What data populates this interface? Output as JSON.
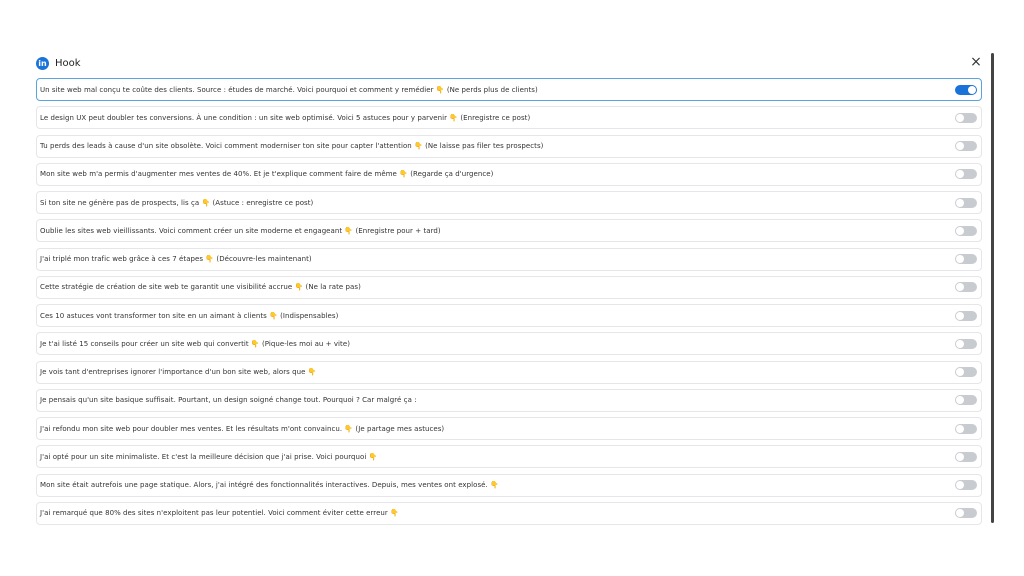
{
  "header": {
    "title": "Hook",
    "logo_text": "in",
    "close_label": "×"
  },
  "accent_color": "#1a73d9",
  "items": [
    {
      "text": "Un site web mal conçu te coûte des clients. Source : études de marché. Voici pourquoi et comment y remédier 👇 (Ne perds plus de clients)",
      "enabled": true
    },
    {
      "text": "Le design UX peut doubler tes conversions. À une condition : un site web optimisé. Voici 5 astuces pour y parvenir 👇 (Enregistre ce post)",
      "enabled": false
    },
    {
      "text": "Tu perds des leads à cause d'un site obsolète. Voici comment moderniser ton site pour capter l'attention 👇 (Ne laisse pas filer tes prospects)",
      "enabled": false
    },
    {
      "text": "Mon site web m'a permis d'augmenter mes ventes de 40%. Et je t'explique comment faire de même 👇 (Regarde ça d'urgence)",
      "enabled": false
    },
    {
      "text": "Si ton site ne génère pas de prospects, lis ça 👇 (Astuce : enregistre ce post)",
      "enabled": false
    },
    {
      "text": "Oublie les sites web vieillissants. Voici comment créer un site moderne et engageant 👇 (Enregistre pour + tard)",
      "enabled": false
    },
    {
      "text": "J'ai triplé mon trafic web grâce à ces 7 étapes 👇 (Découvre-les maintenant)",
      "enabled": false
    },
    {
      "text": "Cette stratégie de création de site web te garantit une visibilité accrue 👇 (Ne la rate pas)",
      "enabled": false
    },
    {
      "text": "Ces 10 astuces vont transformer ton site en un aimant à clients 👇 (Indispensables)",
      "enabled": false
    },
    {
      "text": "Je t'ai listé 15 conseils pour créer un site web qui convertit 👇 (Pique-les moi au + vite)",
      "enabled": false
    },
    {
      "text": "Je vois tant d'entreprises ignorer l'importance d'un bon site web, alors que 👇",
      "enabled": false
    },
    {
      "text": "Je pensais qu'un site basique suffisait. Pourtant, un design soigné change tout. Pourquoi ? Car malgré ça :",
      "enabled": false
    },
    {
      "text": "J'ai refondu mon site web pour doubler mes ventes. Et les résultats m'ont convaincu. 👇 (Je partage mes astuces)",
      "enabled": false
    },
    {
      "text": "J'ai opté pour un site minimaliste. Et c'est la meilleure décision que j'ai prise. Voici pourquoi 👇",
      "enabled": false
    },
    {
      "text": "Mon site était autrefois une page statique. Alors, j'ai intégré des fonctionnalités interactives. Depuis, mes ventes ont explosé. 👇",
      "enabled": false
    },
    {
      "text": "J'ai remarqué que 80% des sites n'exploitent pas leur potentiel. Voici comment éviter cette erreur 👇",
      "enabled": false
    }
  ]
}
